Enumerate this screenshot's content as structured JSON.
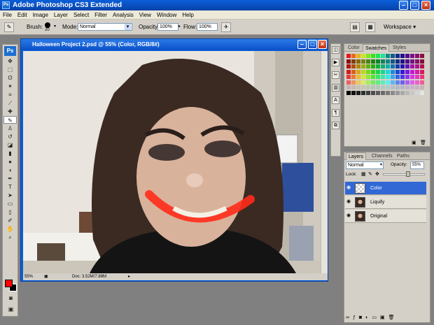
{
  "app": {
    "title": "Adobe Photoshop CS3 Extended",
    "logo": "Ps"
  },
  "menu": [
    "File",
    "Edit",
    "Image",
    "Layer",
    "Select",
    "Filter",
    "Analysis",
    "View",
    "Window",
    "Help"
  ],
  "options": {
    "brush_label": "Brush:",
    "brush_size": "20",
    "mode_label": "Mode:",
    "mode_value": "Normal",
    "opacity_label": "Opacity:",
    "opacity_value": "100%",
    "flow_label": "Flow:",
    "flow_value": "100%",
    "workspace_label": "Workspace ▾"
  },
  "document": {
    "title": "Halloween Project 2.psd @ 55% (Color, RGB/8#)",
    "zoom": "55%",
    "doc_size": "Doc: 3.52M/7.88M"
  },
  "swatches_panel": {
    "tabs": [
      "Color",
      "Swatches",
      "Styles"
    ],
    "active_tab": "Swatches"
  },
  "layers_panel": {
    "tabs": [
      "Layers",
      "Channels",
      "Paths"
    ],
    "active_tab": "Layers",
    "blend_mode": "Normal",
    "opacity_label": "Opacity:",
    "opacity_value": "55%",
    "lock_label": "Lock:",
    "layers": [
      {
        "name": "Color",
        "selected": true
      },
      {
        "name": "Liquify",
        "selected": false
      },
      {
        "name": "Original",
        "selected": false
      }
    ]
  },
  "colors": {
    "foreground": "#ff0000",
    "background": "#000000",
    "titlebar": "#0a5fd8",
    "selected_layer": "#3168d5"
  }
}
